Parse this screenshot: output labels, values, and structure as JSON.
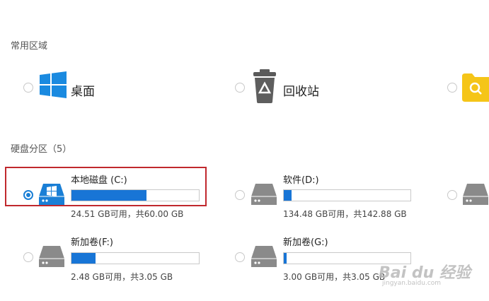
{
  "sections": {
    "common_title": "常用区域",
    "drives_title": "硬盘分区（5）"
  },
  "quick_access": [
    {
      "label": "桌面",
      "icon": "windows-desktop-icon",
      "selected": false
    },
    {
      "label": "回收站",
      "icon": "recycle-bin-icon",
      "selected": false
    },
    {
      "label": "",
      "icon": "search-folder-icon",
      "selected": false
    }
  ],
  "drives": [
    {
      "name": "本地磁盘 (C:)",
      "info": "24.51 GB可用，共60.00 GB",
      "used_fraction": 0.59,
      "selected": true,
      "icon": "system-drive-icon"
    },
    {
      "name": "软件(D:)",
      "info": "134.48 GB可用，共142.88 GB",
      "used_fraction": 0.06,
      "selected": false,
      "icon": "hard-drive-icon"
    },
    {
      "name": "",
      "info": "",
      "used_fraction": 0,
      "selected": false,
      "icon": "hard-drive-icon"
    },
    {
      "name": "新加卷(F:)",
      "info": "2.48 GB可用，共3.05 GB",
      "used_fraction": 0.19,
      "selected": false,
      "icon": "hard-drive-icon"
    },
    {
      "name": "新加卷(G:)",
      "info": "3.00 GB可用，共3.05 GB",
      "used_fraction": 0.02,
      "selected": false,
      "icon": "hard-drive-icon"
    }
  ],
  "watermark": {
    "text": "Bai du 经验",
    "sub": "jingyan.baidu.com"
  },
  "colors": {
    "accent": "#1875d6",
    "highlight": "#c0282d",
    "windows": "#1a8ae0",
    "folder": "#f5c518"
  }
}
